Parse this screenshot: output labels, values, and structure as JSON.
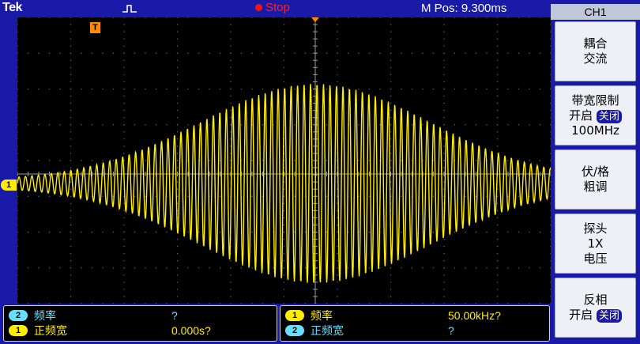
{
  "header": {
    "brand": "Tek",
    "status": "Stop",
    "m_pos": "M Pos: 9.300ms",
    "trigger_mode_icon": "trigger-pulse-icon"
  },
  "channel_marker": "1",
  "trigger_marker": "T",
  "side_menu": {
    "title": "CH1",
    "buttons": [
      {
        "line1": "耦合",
        "line2": "交流"
      },
      {
        "line1": "带宽限制",
        "line2_prefix": "开启",
        "line2_box": "关闭",
        "line3": "100MHz"
      },
      {
        "line1": "伏/格",
        "line2": "粗调"
      },
      {
        "line1": "探头",
        "line2": "1X",
        "line3": "电压"
      },
      {
        "line1": "反相",
        "line2_prefix": "开启",
        "line2_box": "关闭"
      }
    ]
  },
  "measurements": {
    "left": [
      {
        "channel": "2",
        "label": "频率",
        "value": "?"
      },
      {
        "channel": "1",
        "label": "正频宽",
        "value": "0.000s?"
      }
    ],
    "right": [
      {
        "channel": "1",
        "label": "频率",
        "value": "50.00kHz?"
      },
      {
        "channel": "2",
        "label": "正频宽",
        "value": "?"
      }
    ]
  },
  "colors": {
    "trace": "#ffee00",
    "frame": "#1a1aa8",
    "ch2": "#66e0ff",
    "stop": "#ff2020",
    "trigger": "#ff8c00"
  }
}
